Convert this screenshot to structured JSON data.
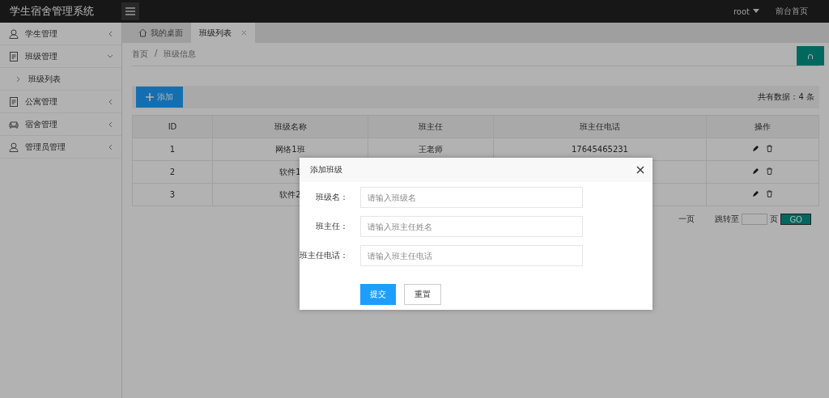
{
  "header": {
    "title": "学生宿舍管理系统",
    "user": "root",
    "home_link": "前台首页"
  },
  "sidebar": {
    "items": [
      {
        "label": "学生管理",
        "expanded": false
      },
      {
        "label": "班级管理",
        "expanded": true,
        "children": [
          {
            "label": "班级列表"
          }
        ]
      },
      {
        "label": "公寓管理",
        "expanded": false
      },
      {
        "label": "宿舍管理",
        "expanded": false
      },
      {
        "label": "管理员管理",
        "expanded": false
      }
    ]
  },
  "tabs": [
    {
      "label": "我的桌面",
      "selected": false,
      "closable": false
    },
    {
      "label": "班级列表",
      "selected": true,
      "closable": true
    }
  ],
  "breadcrumb": [
    "首页",
    "班级信息"
  ],
  "breadcrumb_separator": "/",
  "toolbar": {
    "add_button": "添加",
    "total": "共有数据：4 条"
  },
  "table": {
    "columns": [
      "ID",
      "班级名称",
      "班主任",
      "班主任电话",
      "操作"
    ],
    "rows": [
      {
        "id": "1",
        "name": "网络1班",
        "teacher": "王老师",
        "phone": "17645465231"
      },
      {
        "id": "2",
        "name": "软件1"
      },
      {
        "id": "3",
        "name": "软件2"
      }
    ]
  },
  "pagination": {
    "next": "一页",
    "jump_label": "跳转至",
    "page_label": "页",
    "go_button": "GO"
  },
  "dialog": {
    "title": "添加班级",
    "fields": [
      {
        "label": "班级名：",
        "placeholder": "请输入班级名"
      },
      {
        "label": "班主任：",
        "placeholder": "请输入班主任姓名"
      },
      {
        "label": "班主任电话：",
        "placeholder": "请输入班主任电话"
      }
    ],
    "submit": "提交",
    "reset": "重置"
  }
}
